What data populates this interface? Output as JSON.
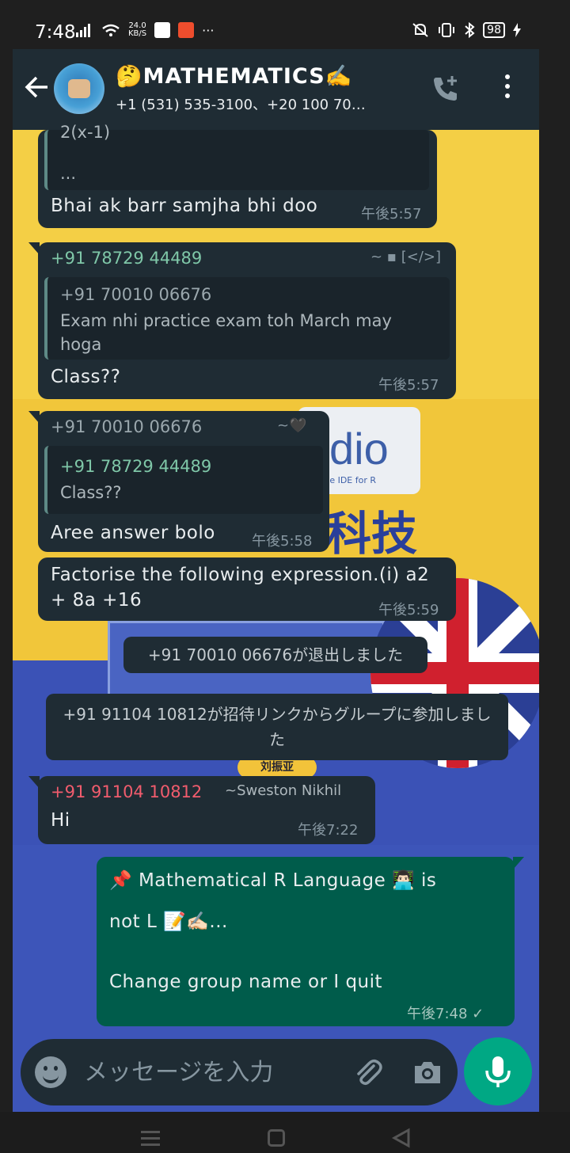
{
  "status_bar": {
    "time": "7:48",
    "network_speed": "24.0",
    "network_speed_unit": "KB/S",
    "overflow": "···",
    "battery": "98"
  },
  "header": {
    "title": "🤔MATHEMATICS✍️",
    "members": "+1 (531) 535-3100、+20 100 70…"
  },
  "messages": {
    "m1": {
      "quote_text": "...",
      "quote_top": "2(x-1)",
      "text": "Bhai ak barr samjha bhi doo",
      "time": "午後5:57"
    },
    "m2": {
      "sender": "+91 78729 44489",
      "sender_tag": "~ ▪ [</>]",
      "quote_sender": "+91 70010 06676",
      "quote_text": "Exam nhi practice exam toh March may hoga",
      "text": "Class??",
      "time": "午後5:57"
    },
    "m3": {
      "sender": "+91 70010 06676",
      "sender_tag": "~🖤",
      "quote_sender": "+91 78729 44489",
      "quote_text": "Class??",
      "text": "Aree answer bolo",
      "time": "午後5:58"
    },
    "m4": {
      "text": "Factorise the following expression.(i) a2 + 8a +16",
      "time": "午後5:59"
    },
    "system1": "+91 70010 06676が退出しました",
    "system2": "+91 91104 10812が招待リンクからグループに参加しました",
    "m5": {
      "sender": "+91 91104 10812",
      "sender_tag": "~Sweston Nikhil",
      "text": "Hi",
      "time": "午後7:22"
    },
    "m6": {
      "line1": "📌 Mathematical R Language 👨🏻‍💻 is",
      "line2": "not L 📝✍🏻...",
      "line3": "Change group name or I quit",
      "time": "午後7:48 ✓"
    }
  },
  "wallpaper": {
    "card_text": "dio",
    "card_sub": "rce IDE for R",
    "kanji": "科技",
    "nameplate": "刘振亚"
  },
  "input": {
    "placeholder": "メッセージを入力"
  },
  "colors": {
    "header_bg": "#1f2c34",
    "incoming_bubble": "#1f2c34",
    "outgoing_bubble": "#005c4b",
    "accent": "#00a884",
    "sender_green": "#53bdeb",
    "sender_red": "#f15c6d"
  },
  "icons": {
    "back": "arrow-left-icon",
    "call": "add-call-icon",
    "menu": "more-vertical-icon",
    "emoji": "emoji-icon",
    "attach": "paperclip-icon",
    "camera": "camera-icon",
    "mic": "microphone-icon"
  }
}
